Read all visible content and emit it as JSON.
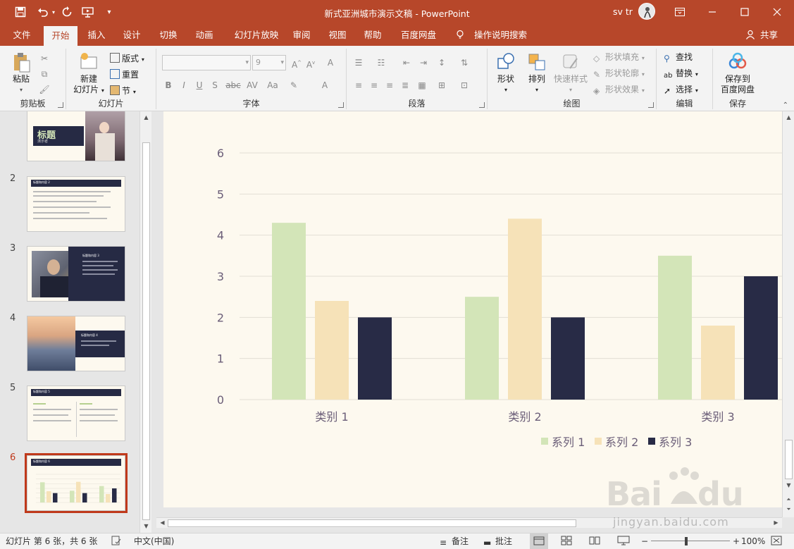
{
  "window": {
    "title": "新式亚洲城市演示文稿 - PowerPoint",
    "user_name": "sv tr"
  },
  "quick_access": {
    "icons": [
      "save-icon",
      "undo-icon",
      "redo-icon",
      "present-from-start-icon",
      "customize-qat-icon"
    ]
  },
  "tabs": [
    {
      "label": "文件"
    },
    {
      "label": "开始"
    },
    {
      "label": "插入"
    },
    {
      "label": "设计"
    },
    {
      "label": "切换"
    },
    {
      "label": "动画"
    },
    {
      "label": "幻灯片放映"
    },
    {
      "label": "审阅"
    },
    {
      "label": "视图"
    },
    {
      "label": "帮助"
    },
    {
      "label": "百度网盘"
    }
  ],
  "active_tab": "开始",
  "tell_me": "操作说明搜索",
  "share": "共享",
  "ribbon": {
    "clipboard": {
      "label": "剪贴板",
      "paste": "粘贴"
    },
    "slides": {
      "label": "幻灯片",
      "new_slide_line1": "新建",
      "new_slide_line2": "幻灯片",
      "layout": "版式",
      "reset": "重置",
      "section": "节"
    },
    "font": {
      "label": "字体",
      "font_name": "",
      "font_size": "9",
      "bold": "B",
      "italic": "I",
      "underline": "U",
      "shadow": "S",
      "strike": "abc",
      "spacing": "AV",
      "case": "Aa"
    },
    "paragraph": {
      "label": "段落"
    },
    "drawing": {
      "label": "绘图",
      "shapes": "形状",
      "arrange": "排列",
      "quick_styles": "快速样式",
      "shape_fill": "形状填充",
      "shape_outline": "形状轮廓",
      "shape_effects": "形状效果"
    },
    "editing": {
      "label": "编辑",
      "find": "查找",
      "replace": "替换",
      "select": "选择"
    },
    "save": {
      "label": "保存",
      "save_to_line1": "保存到",
      "save_to_line2": "百度网盘"
    }
  },
  "slide_pane": {
    "slides": [
      {
        "number": "",
        "title": "标题",
        "subtitle": "演示者"
      },
      {
        "number": "2",
        "title": "标题和内容 2"
      },
      {
        "number": "3",
        "title": "标题和内容 3"
      },
      {
        "number": "4",
        "title": "标题和内容 4"
      },
      {
        "number": "5",
        "title": "标题和内容 5"
      },
      {
        "number": "6",
        "title": "标题和内容 6"
      }
    ],
    "selected": "6"
  },
  "chart_data": {
    "type": "bar",
    "categories": [
      "类别 1",
      "类别 2",
      "类别 3"
    ],
    "series": [
      {
        "name": "系列 1",
        "values": [
          4.3,
          2.5,
          3.5
        ],
        "color": "#d3e5b8"
      },
      {
        "name": "系列 2",
        "values": [
          2.4,
          4.4,
          1.8
        ],
        "color": "#f6e2b8"
      },
      {
        "name": "系列 3",
        "values": [
          2,
          2,
          3
        ],
        "color": "#282b46"
      }
    ],
    "yticks": [
      "0",
      "1",
      "2",
      "3",
      "4",
      "5",
      "6"
    ],
    "ylim": [
      0,
      6
    ],
    "grid": true,
    "legend": "bottom",
    "gridcolor": "#e2ded5",
    "label_color": "#6b5e78"
  },
  "statusbar": {
    "slide_info": "幻灯片 第 6 张，共 6 张",
    "language": "中文(中国)",
    "notes": "备注",
    "comments": "批注",
    "zoom": "100%"
  },
  "watermark": {
    "url": "jingyan.baidu.com"
  },
  "colors": {
    "brand": "#b7472a",
    "selection": "#c0391b"
  }
}
